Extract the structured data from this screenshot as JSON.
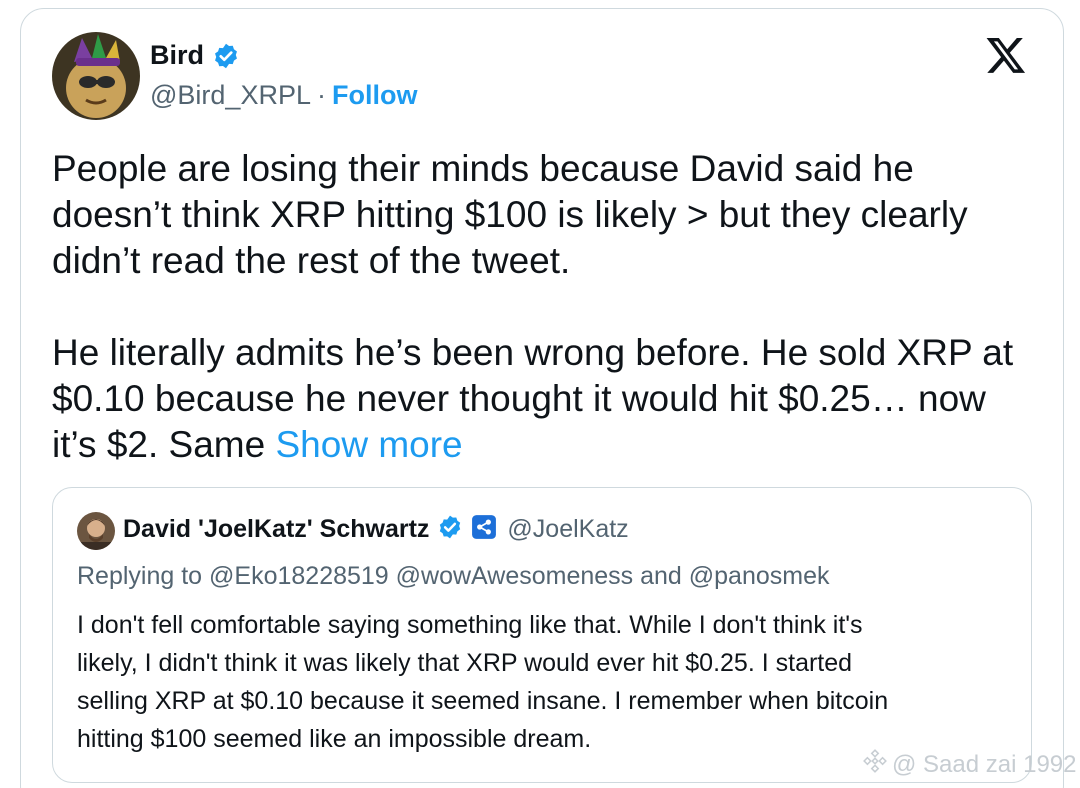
{
  "author": {
    "display_name": "Bird",
    "handle": "@Bird_XRPL",
    "separator": "·",
    "follow_label": "Follow"
  },
  "tweet": {
    "lines": [
      "People are losing their minds because David said he",
      "doesn’t think XRP hitting $100 is likely > but they clearly",
      "didn’t read the rest of the tweet.",
      "He literally admits he’s been wrong before. He sold XRP at",
      "$0.10 because he never thought it would hit $0.25… now",
      "it’s $2. Same "
    ],
    "show_more": "Show more"
  },
  "quoted": {
    "display_name": "David 'JoelKatz' Schwartz",
    "handle": "@JoelKatz",
    "replying_to": "Replying to @Eko18228519 @wowAwesomeness and @panosmek",
    "lines": [
      "I don't fell comfortable saying something like that. While I don't think it's",
      "likely, I didn't think it was likely that XRP would ever hit $0.25. I started",
      "selling XRP at $0.10 because it seemed insane. I remember when bitcoin",
      "hitting $100 seemed like an impossible dream."
    ]
  },
  "watermark": {
    "text": "@ Saad zai 1992"
  },
  "icons": {
    "verified": "verified-badge-icon",
    "x_logo": "x-logo-icon",
    "affiliate": "affiliate-badge-icon",
    "watermark": "binance-logo-icon"
  },
  "colors": {
    "link": "#1d9bf0",
    "text": "#0f1419",
    "muted": "#536471",
    "border": "#cfd9de"
  }
}
